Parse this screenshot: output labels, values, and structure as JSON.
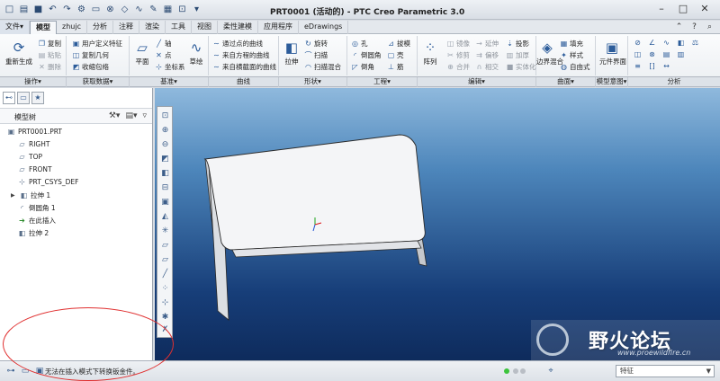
{
  "window": {
    "title": "PRT0001 (活动的) - PTC Creo Parametric 3.0"
  },
  "tabs": [
    {
      "label": "文件▾"
    },
    {
      "label": "模型"
    },
    {
      "label": "zhujc"
    },
    {
      "label": "分析"
    },
    {
      "label": "注释"
    },
    {
      "label": "渲染"
    },
    {
      "label": "工具"
    },
    {
      "label": "视图"
    },
    {
      "label": "柔性建模"
    },
    {
      "label": "应用程序"
    },
    {
      "label": "eDrawings"
    }
  ],
  "ribbon": {
    "operations": {
      "regen": "重新生成",
      "copy": "复制",
      "paste": "粘贴",
      "delete": "删除"
    },
    "getdata": {
      "udf": "用户定义特征",
      "copygeom": "复制几何",
      "shrinkwrap": "收缩包络"
    },
    "datum": {
      "plane": "平面",
      "axis": "轴",
      "point": "点",
      "csys": "坐标系",
      "sketch": "草绘"
    },
    "curves": {
      "c1": "通过点的曲线",
      "c2": "来自方程的曲线",
      "c3": "来自横截面的曲线"
    },
    "shapes": {
      "extrude": "拉伸",
      "revolve": "旋转",
      "sweep": "扫描",
      "blend": "扫描混合"
    },
    "engineering": {
      "hole": "孔",
      "round": "倒圆角",
      "chamfer": "倒角",
      "draft": "拔模",
      "shell": "壳",
      "rib": "筋"
    },
    "editing": {
      "pattern": "阵列",
      "mirror": "镜像",
      "trim": "修剪",
      "merge": "合并",
      "extend": "延伸",
      "offset": "偏移",
      "intersect": "相交",
      "project": "投影",
      "thicken": "加厚",
      "solidify": "实体化"
    },
    "surfaces": {
      "boundary": "边界混合",
      "fill": "填充",
      "style": "样式",
      "freestyle": "自由式"
    },
    "intent": {
      "label": "元件界面"
    }
  },
  "group_labels": [
    "操作▾",
    "获取数据▾",
    "基准▾",
    "曲线",
    "形状▾",
    "工程▾",
    "编辑▾",
    "曲面▾",
    "模型意图▾",
    "分析"
  ],
  "model_tree": {
    "title": "模型树",
    "items": [
      {
        "label": "PRT0001.PRT"
      },
      {
        "label": "RIGHT"
      },
      {
        "label": "TOP"
      },
      {
        "label": "FRONT"
      },
      {
        "label": "PRT_CSYS_DEF"
      },
      {
        "label": "拉伸 1"
      },
      {
        "label": "倒圆角 1"
      },
      {
        "label": "在此插入"
      },
      {
        "label": "拉伸 2"
      }
    ]
  },
  "status": {
    "message": "无法在插入模式下转换钣金件。",
    "filter": "特征"
  },
  "watermark": {
    "text": "野火论坛",
    "url": "www.proewildfire.cn"
  },
  "colors": {
    "accent": "#2c5c9a",
    "annotation": "#e03030",
    "viewport_top": "#8fb9dd",
    "viewport_bottom": "#0e2b5c"
  }
}
